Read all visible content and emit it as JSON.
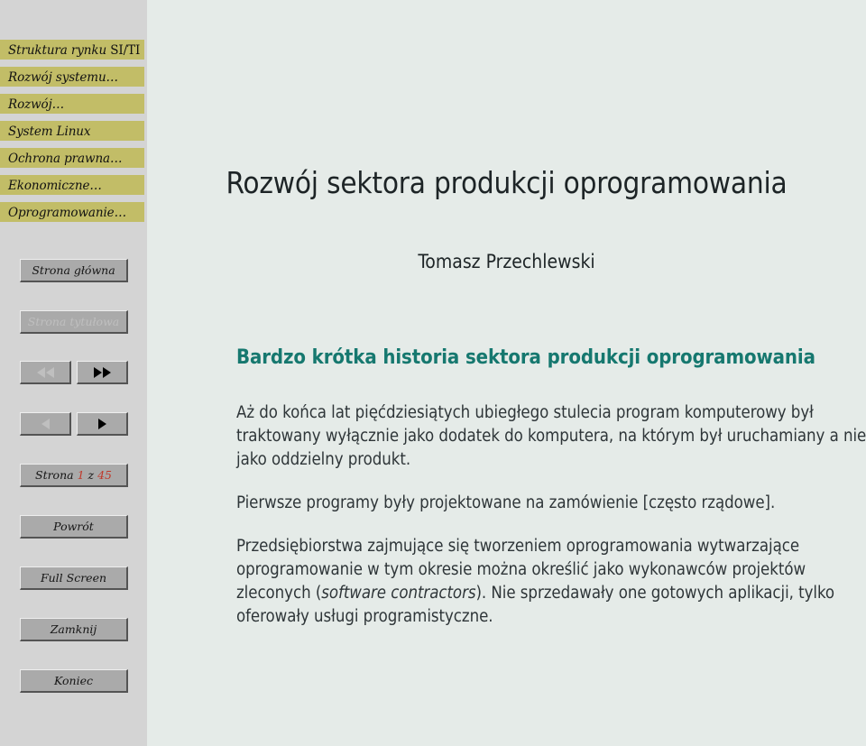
{
  "sidebar": {
    "menu": [
      {
        "label": "Struktura rynku SI/TI",
        "name": "sidebar-section-struktura-rynku",
        "italic_part": "Struktura rynku",
        "serif_part": "SI/TI"
      },
      {
        "label": "Rozwój systemu…",
        "name": "sidebar-section-rozwoj-systemu",
        "italic_part": "Rozwój systemu",
        "serif_part": ""
      },
      {
        "label": "Rozwój…",
        "name": "sidebar-section-rozwoj",
        "italic_part": "Rozwój",
        "serif_part": ""
      },
      {
        "label": "System Linux",
        "name": "sidebar-section-system-linux",
        "italic_part": "System Linux",
        "serif_part": ""
      },
      {
        "label": "Ochrona prawna…",
        "name": "sidebar-section-ochrona-prawna",
        "italic_part": "Ochrona prawna",
        "serif_part": ""
      },
      {
        "label": "Ekonomiczne…",
        "name": "sidebar-section-ekonomiczne",
        "italic_part": "Ekonomiczne",
        "serif_part": ""
      },
      {
        "label": "Oprogramowanie…",
        "name": "sidebar-section-oprogramowanie",
        "italic_part": "Oprogramowanie",
        "serif_part": ""
      }
    ],
    "buttons": {
      "home": "Strona główna",
      "title_page": "Strona tytułowa",
      "back": "Powrót",
      "full_screen": "Full Screen",
      "close": "Zamknij",
      "quit": "Koniec"
    },
    "nav_icons": {
      "first": "double-arrow-left-icon",
      "last": "double-arrow-right-icon",
      "prev": "arrow-left-icon",
      "next": "arrow-right-icon"
    },
    "page_counter": {
      "prefix": "Strona",
      "current": "1",
      "separator": "z",
      "total": "45"
    },
    "disabled_states": {
      "title_page": true,
      "first": true,
      "prev": true,
      "last": false,
      "next": false
    }
  },
  "slide": {
    "title": "Rozwój sektora produkcji oprogramowania",
    "author": "Tomasz Przechlewski",
    "section_heading": "Bardzo krótka historia sektora produkcji oprogramowania",
    "paragraphs": [
      {
        "id": "p1",
        "text": "Aż do końca lat pięćdziesiątych ubiegłego stulecia program komputerowy był traktowany wyłącznie jako dodatek do komputera, na którym był uruchamiany a nie jako oddzielny produkt."
      },
      {
        "id": "p2",
        "text": "Pierwsze programy były projektowane na zamówienie [często rządowe]."
      },
      {
        "id": "p3",
        "text_before": "Przedsiębiorstwa zajmujące się tworzeniem oprogramowania wytwarzające oprogramowanie w tym okresie można określić jako wykonawców projektów zleconych (",
        "text_italic": "software contractors",
        "text_after": "). Nie sprzedawały one gotowych aplikacji, tylko oferowały usługi programistyczne."
      }
    ]
  },
  "colors": {
    "sidebar_bg": "#d4d4d4",
    "menu_item_bg": "#c2bd67",
    "content_bg": "#e5ebe8",
    "heading_teal": "#16786f",
    "body_text": "#2e3538",
    "page_number_red": "#c0392b",
    "button_face": "#aaaaaa",
    "button_disabled_text": "#bfbfbf"
  }
}
